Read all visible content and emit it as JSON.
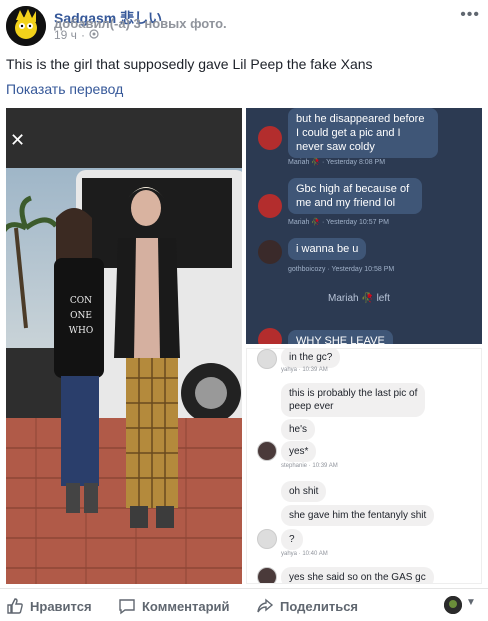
{
  "post": {
    "author": "Sadgasm 悲しい",
    "action": "добавил(-а) 3 новых фото.",
    "time": "19 ч",
    "privacy_icon": "gear-globe-icon",
    "text": "This is the girl that supposedly gave Lil Peep the fake Xans",
    "translate_link": "Показать перевод"
  },
  "dark_chat": {
    "messages": [
      {
        "text_lines": [
          "but he disappeared before",
          "I could get a pic and I",
          "never saw coldy"
        ],
        "meta": "Mariah 🥀 · Yesterday 8:08 PM"
      },
      {
        "text_lines": [
          "Gbc high af because of",
          "me and my friend lol"
        ],
        "meta": "Mariah 🥀 · Yesterday 10:57 PM"
      },
      {
        "text_lines": [
          "i wanna be u"
        ],
        "meta": "gothboicozy · Yesterday 10:58 PM"
      }
    ],
    "system": "Mariah 🥀 left",
    "last": "WHY SHE LEAVE"
  },
  "light_chat": {
    "messages": [
      {
        "text": "in the gc?",
        "meta": "yahya · 10:39 AM"
      },
      {
        "text_lines": [
          "this is probably the last pic of",
          "peep ever"
        ]
      },
      {
        "text": "he's"
      },
      {
        "text": "yes*",
        "meta": "stephanie · 10:39 AM"
      },
      {
        "text": "oh shit"
      },
      {
        "text": "she gave him the fentanyly shit"
      },
      {
        "text": "?",
        "meta": "yahya · 10:40 AM"
      },
      {
        "text": "yes she said so on the GAS gc"
      }
    ]
  },
  "actions": {
    "like": "Нравится",
    "comment": "Комментарий",
    "share": "Поделиться"
  },
  "icons": {
    "close": "✕",
    "more": "•••"
  }
}
